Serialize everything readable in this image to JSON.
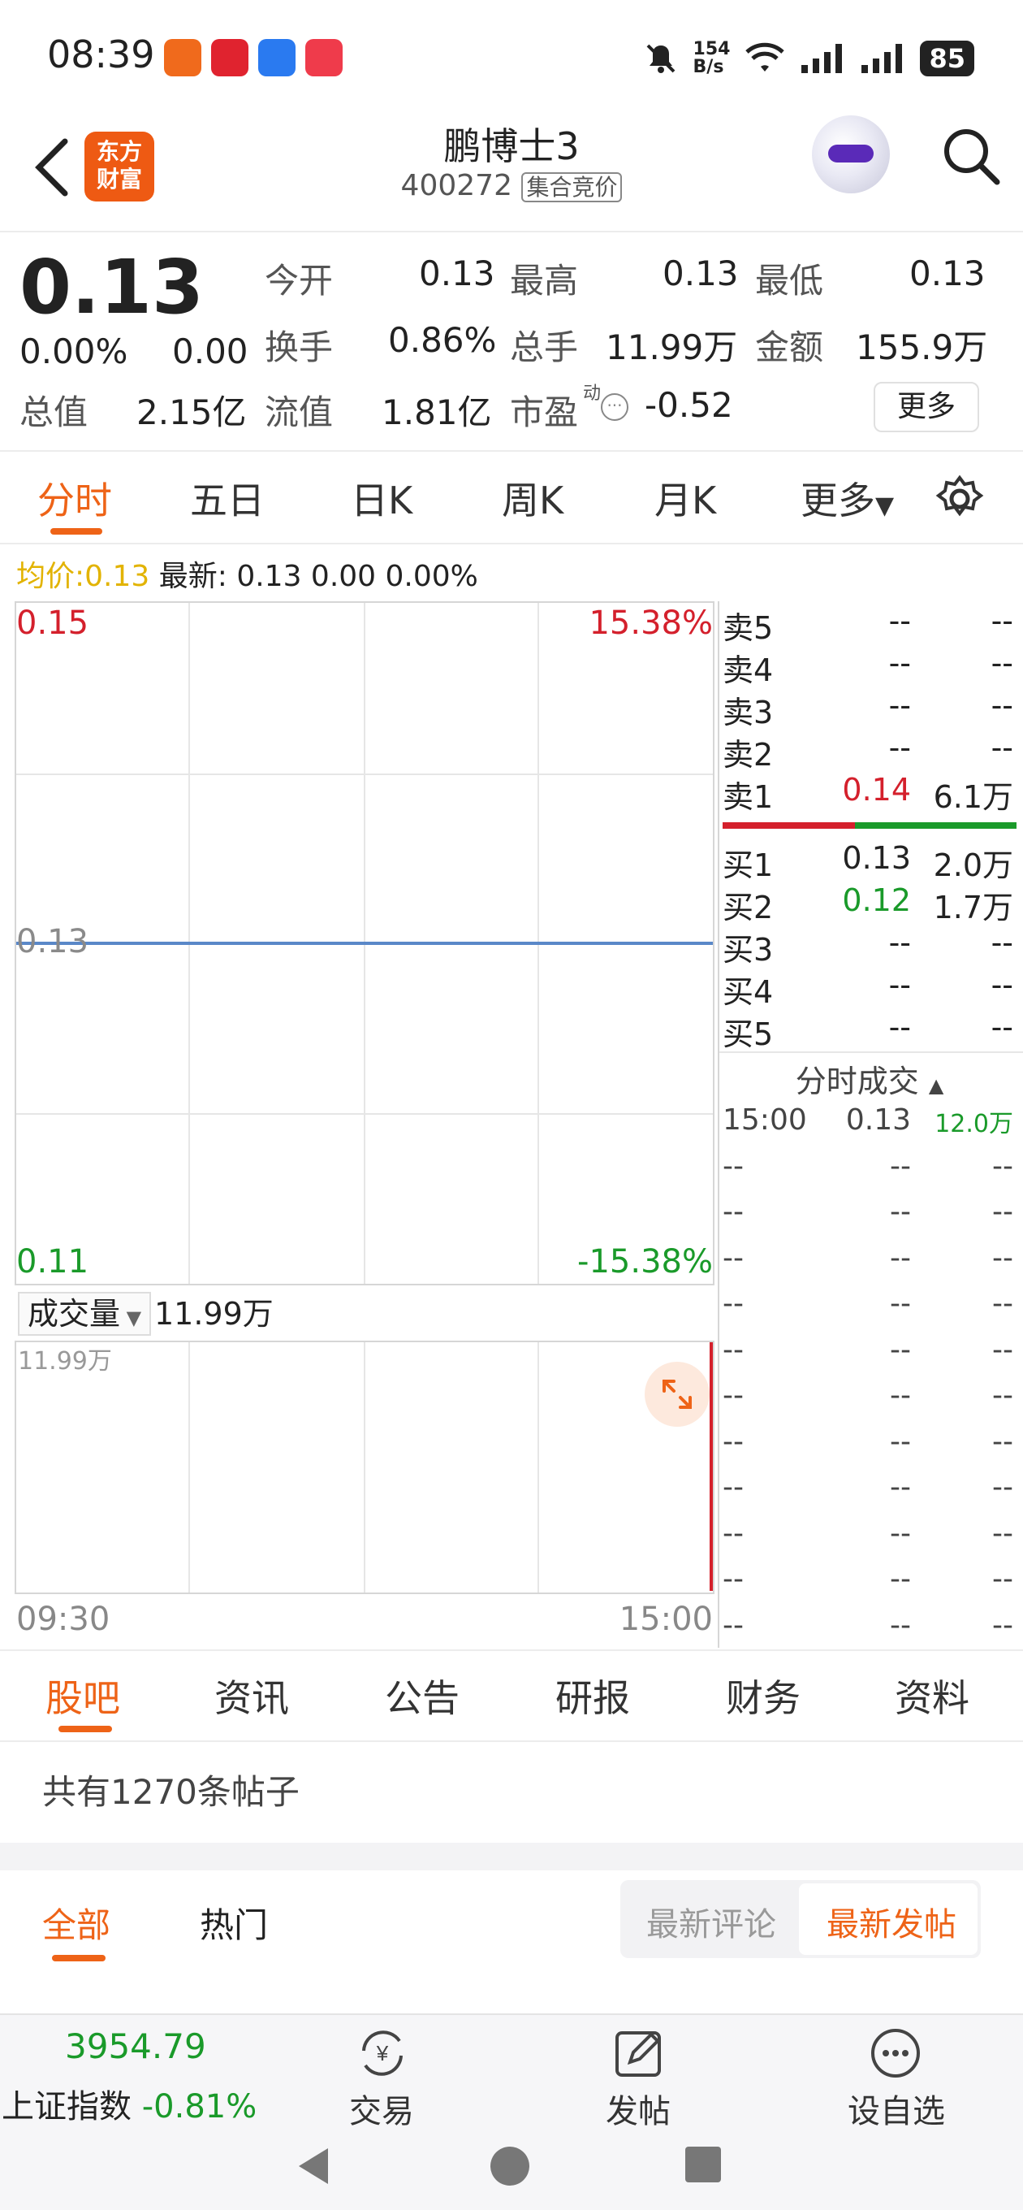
{
  "status_bar": {
    "time": "08:39",
    "net_speed": "154\nB/s",
    "battery": "85"
  },
  "header": {
    "logo_text": "东方\n财富",
    "title": "鹏博士3",
    "code": "400272",
    "tag": "集合竞价"
  },
  "quote": {
    "price": "0.13",
    "change_pct": "0.00%",
    "change": "0.00",
    "rows": [
      [
        {
          "label": "今开",
          "value": "0.13"
        },
        {
          "label": "最高",
          "value": "0.13"
        },
        {
          "label": "最低",
          "value": "0.13"
        }
      ],
      [
        {
          "label": "换手",
          "value": "0.86%"
        },
        {
          "label": "总手",
          "value": "11.99万"
        },
        {
          "label": "金额",
          "value": "155.9万"
        }
      ]
    ],
    "total_value_label": "总值",
    "total_value": "2.15亿",
    "float_value_label": "流值",
    "float_value": "1.81亿",
    "pe_label": "市盈",
    "pe_sup": "动",
    "pe_value": "-0.52",
    "more_button": "更多"
  },
  "chart_tabs": [
    "分时",
    "五日",
    "日K",
    "周K",
    "月K",
    "更多"
  ],
  "chart_tab_active": "分时",
  "avg_line": {
    "avg_label": "均价:",
    "avg_value": "0.13",
    "latest": "最新: 0.13 0.00 0.00%"
  },
  "chart_data": {
    "type": "line",
    "x_start": "09:30",
    "x_end": "15:00",
    "price_high_label": "0.15",
    "price_mid_label": "0.13",
    "price_low_label": "0.11",
    "pct_high_label": "15.38%",
    "pct_low_label": "-15.38%",
    "ylim": [
      0.11,
      0.15
    ],
    "series": [
      {
        "values": [
          0.13,
          0.13
        ]
      }
    ],
    "volume_selector": "成交量",
    "volume_value": "11.99万",
    "volume_axis_max": "11.99万",
    "volume_bars": [
      {
        "time": "15:00",
        "value": 11.99
      }
    ]
  },
  "order_book": {
    "asks": [
      {
        "label": "卖5",
        "price": "--",
        "vol": "--"
      },
      {
        "label": "卖4",
        "price": "--",
        "vol": "--"
      },
      {
        "label": "卖3",
        "price": "--",
        "vol": "--"
      },
      {
        "label": "卖2",
        "price": "--",
        "vol": "--"
      },
      {
        "label": "卖1",
        "price": "0.14",
        "vol": "6.1万"
      }
    ],
    "bids": [
      {
        "label": "买1",
        "price": "0.13",
        "vol": "2.0万"
      },
      {
        "label": "买2",
        "price": "0.12",
        "vol": "1.7万"
      },
      {
        "label": "买3",
        "price": "--",
        "vol": "--"
      },
      {
        "label": "买4",
        "price": "--",
        "vol": "--"
      },
      {
        "label": "买5",
        "price": "--",
        "vol": "--"
      }
    ],
    "ask_bid_ratio": 0.45
  },
  "trades": {
    "title": "分时成交",
    "rows": [
      {
        "time": "15:00",
        "price": "0.13",
        "vol": "12.0万"
      },
      {
        "time": "--",
        "price": "--",
        "vol": "--"
      },
      {
        "time": "--",
        "price": "--",
        "vol": "--"
      },
      {
        "time": "--",
        "price": "--",
        "vol": "--"
      },
      {
        "time": "--",
        "price": "--",
        "vol": "--"
      },
      {
        "time": "--",
        "price": "--",
        "vol": "--"
      },
      {
        "time": "--",
        "price": "--",
        "vol": "--"
      },
      {
        "time": "--",
        "price": "--",
        "vol": "--"
      },
      {
        "time": "--",
        "price": "--",
        "vol": "--"
      },
      {
        "time": "--",
        "price": "--",
        "vol": "--"
      },
      {
        "time": "--",
        "price": "--",
        "vol": "--"
      },
      {
        "time": "--",
        "price": "--",
        "vol": "--"
      }
    ]
  },
  "bottom_tabs": [
    "股吧",
    "资讯",
    "公告",
    "研报",
    "财务",
    "资料"
  ],
  "bottom_tab_active": "股吧",
  "forum": {
    "count_text": "共有1270条帖子",
    "filter_all": "全部",
    "filter_hot": "热门",
    "sort_comment": "最新评论",
    "sort_post": "最新发帖"
  },
  "footer": {
    "index_value": "3954.79",
    "index_name": "上证指数",
    "index_change": "-0.81%",
    "trade": "交易",
    "post": "发帖",
    "watchlist": "设自选"
  },
  "colors": {
    "accent": "#ee6317",
    "up": "#d4202c",
    "down": "#1a9a2a",
    "line": "#5a88c8"
  }
}
